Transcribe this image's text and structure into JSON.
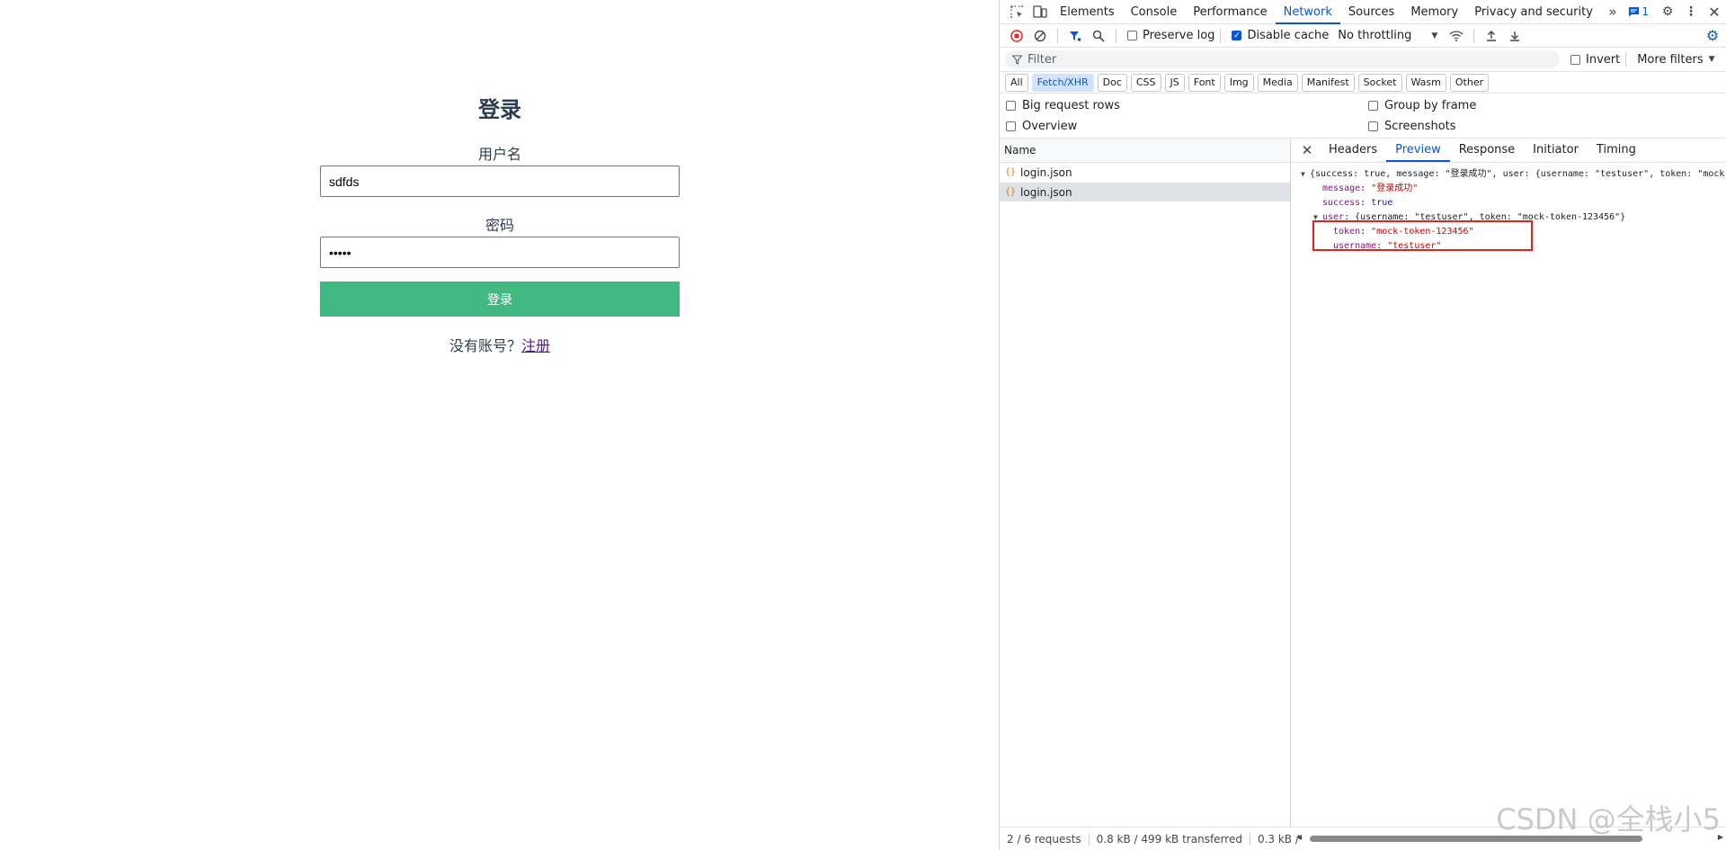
{
  "login": {
    "title": "登录",
    "username_label": "用户名",
    "username_value": "sdfds",
    "password_label": "密码",
    "password_value": "•••••",
    "submit_label": "登录",
    "no_account_text": "没有账号？",
    "register_link": "注册"
  },
  "devtools": {
    "tabs": [
      "Elements",
      "Console",
      "Performance",
      "Network",
      "Sources",
      "Memory",
      "Privacy and security"
    ],
    "active_tab": "Network",
    "issues_count": "1",
    "toolbar": {
      "preserve_log": "Preserve log",
      "disable_cache": "Disable cache",
      "throttling": "No throttling"
    },
    "filter": {
      "placeholder": "Filter",
      "invert": "Invert",
      "more_filters": "More filters"
    },
    "types": [
      "All",
      "Fetch/XHR",
      "Doc",
      "CSS",
      "JS",
      "Font",
      "Img",
      "Media",
      "Manifest",
      "Socket",
      "Wasm",
      "Other"
    ],
    "active_type": "Fetch/XHR",
    "options": {
      "big_rows": "Big request rows",
      "group_by_frame": "Group by frame",
      "overview": "Overview",
      "screenshots": "Screenshots"
    },
    "request_list": {
      "header": "Name",
      "rows": [
        "login.json",
        "login.json"
      ]
    },
    "detail_tabs": [
      "Headers",
      "Preview",
      "Response",
      "Initiator",
      "Timing"
    ],
    "active_detail_tab": "Preview",
    "preview": {
      "summary": "{success: true, message: \"登录成功\", user: {username: \"testuser\", token: \"mock",
      "message_key": "message",
      "message_value": "\"登录成功\"",
      "success_key": "success",
      "success_value": "true",
      "user_key": "user",
      "user_summary": "{username: \"testuser\", token: \"mock-token-123456\"}",
      "token_key": "token",
      "token_value": "\"mock-token-123456\"",
      "username_key": "username",
      "username_value": "\"testuser\""
    },
    "status": {
      "requests": "2 / 6 requests",
      "transferred": "0.8 kB / 499 kB transferred",
      "resources": "0.3 kB /"
    },
    "watermark": "CSDN @全栈小5"
  }
}
